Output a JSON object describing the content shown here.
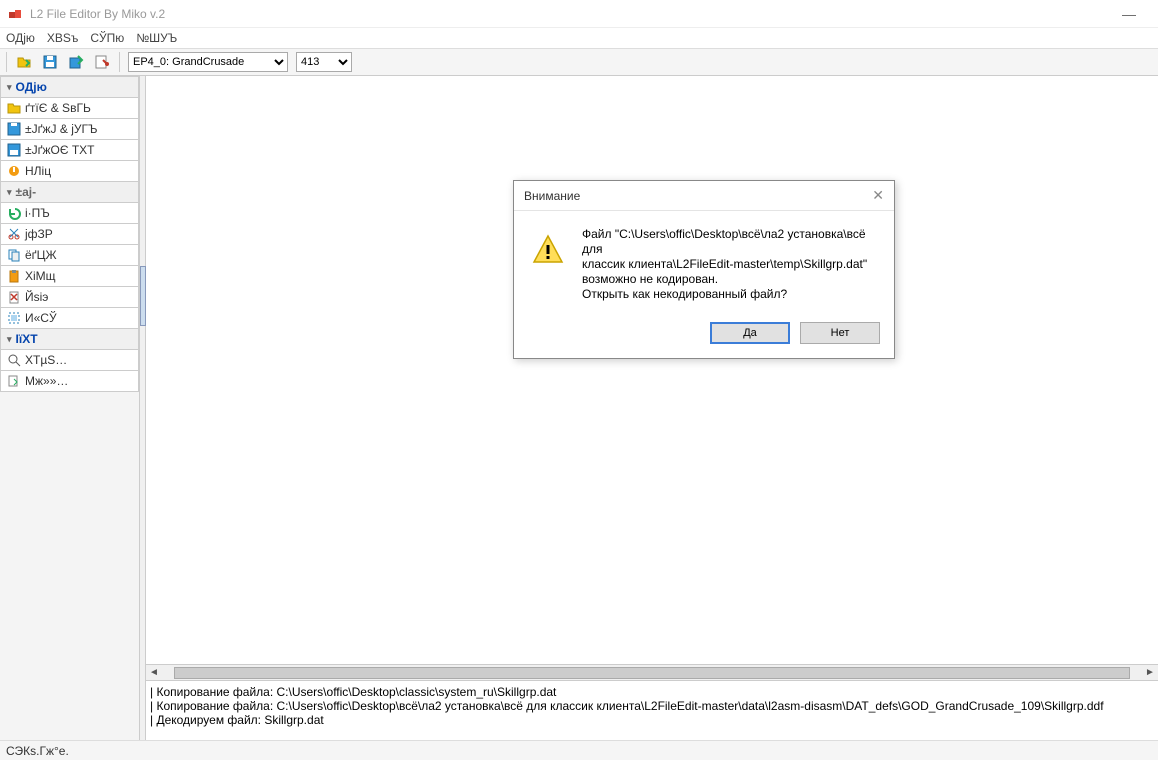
{
  "window": {
    "title": "L2 File Editor By Miko v.2"
  },
  "menu": {
    "items": [
      "ОДјю",
      "ХВЅъ",
      "СЎПю",
      "№ШУЪ"
    ]
  },
  "toolbar": {
    "dropdown1": "EP4_0: GrandCrusade",
    "dropdown2": "413"
  },
  "sidebar": {
    "group1": {
      "header": "ОДјю",
      "items": [
        "ґтїЄ & ЅвГЬ",
        "±ЈґжЈ & јУГЪ",
        "±ЈґжОЄ TXT",
        "НЛіц"
      ]
    },
    "group2": {
      "header": "±ај-",
      "items": [
        "і·ПЪ",
        "јфЗР",
        "ёґЦЖ",
        "ХіМщ",
        "Йѕіэ",
        "И«СЎ"
      ]
    },
    "group3": {
      "header": "ІїХТ",
      "items": [
        "ХТµЅ…",
        "Мж»»…"
      ]
    }
  },
  "dialog": {
    "title": "Внимание",
    "msg_l1": "Файл \"C:\\Users\\offic\\Desktop\\всё\\ла2 установка\\всё для",
    "msg_l2": "классик клиента\\L2FileEdit-master\\temp\\Skillgrp.dat\"",
    "msg_l3": "возможно не кодирован.",
    "msg_l4": "Открыть как некодированный файл?",
    "btn_yes": "Да",
    "btn_no": "Нет"
  },
  "log": {
    "line1": "|   Копирование файла: C:\\Users\\offic\\Desktop\\classic\\system_ru\\Skillgrp.dat",
    "line2": "|   Копирование файла: C:\\Users\\offic\\Desktop\\всё\\ла2 установка\\всё для классик клиента\\L2FileEdit-master\\data\\l2asm-disasm\\DAT_defs\\GOD_GrandCrusade_109\\Skillgrp.ddf",
    "line3": "|   Декодируем файл: Skillgrp.dat"
  },
  "status": {
    "text": "СЭКѕ.Гж°е."
  }
}
